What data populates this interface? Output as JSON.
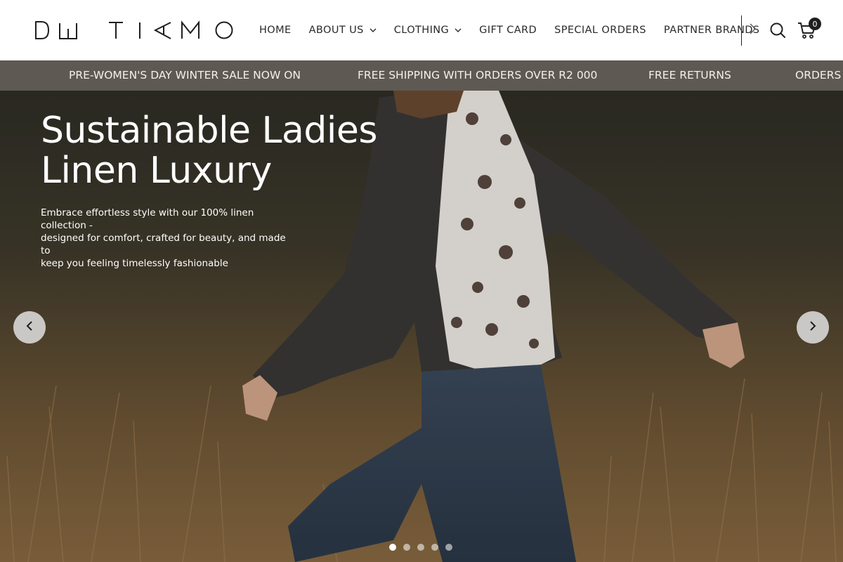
{
  "brand": {
    "logo_text": "DW TIAMO"
  },
  "nav": {
    "items": [
      {
        "label": "HOME",
        "has_dropdown": false
      },
      {
        "label": "ABOUT US",
        "has_dropdown": true
      },
      {
        "label": "CLOTHING",
        "has_dropdown": true
      },
      {
        "label": "GIFT CARD",
        "has_dropdown": false
      },
      {
        "label": "SPECIAL ORDERS",
        "has_dropdown": false
      },
      {
        "label": "PARTNER BRANDS",
        "has_dropdown": false
      }
    ],
    "next_icon": "chevron-right-icon",
    "search_icon": "search-icon",
    "cart_icon": "cart-icon",
    "cart_count": "0"
  },
  "announcement": {
    "messages": [
      "PRE-WOMEN'S DAY WINTER SALE NOW ON",
      "FREE SHIPPING WITH ORDERS OVER R2 000",
      "FREE RETURNS",
      "ORDERS D"
    ],
    "background": "#5f5954",
    "text_color": "#f3f0ec"
  },
  "hero": {
    "title_line1": "Sustainable Ladies",
    "title_line2": "Linen Luxury",
    "subtitle_line1": "Embrace effortless style with our 100% linen collection -",
    "subtitle_line2": "designed for comfort, crafted for beauty, and made to",
    "subtitle_line3": "keep you feeling timelessly fashionable",
    "prev_icon": "chevron-left-icon",
    "next_icon": "chevron-right-icon",
    "slide_count": 5,
    "active_slide": 1
  }
}
